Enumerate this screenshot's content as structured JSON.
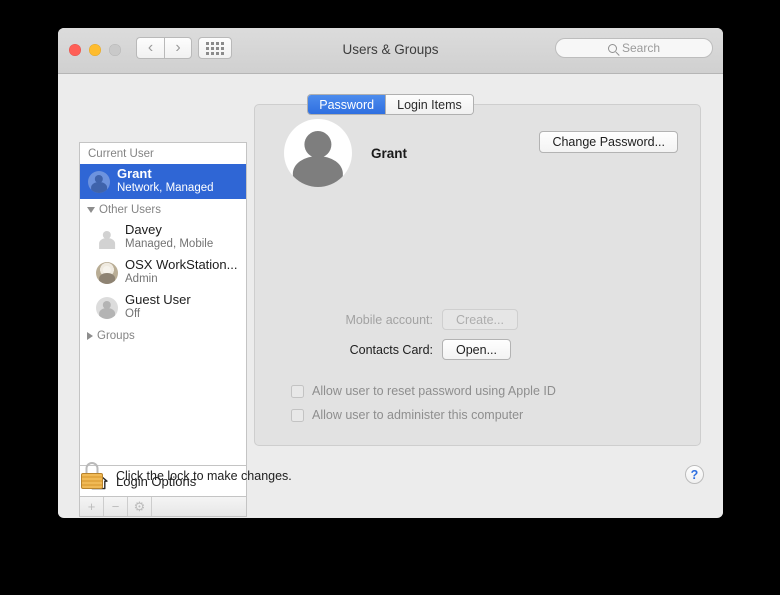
{
  "window": {
    "title": "Users & Groups",
    "traffic_lights": [
      "close",
      "minimize",
      "zoom"
    ],
    "nav_back": "‹",
    "nav_forward": "›",
    "grid_button": "show-all-icon"
  },
  "search": {
    "placeholder": "Search",
    "value": "",
    "icon": "search-icon"
  },
  "sidebar": {
    "current_user_header": "Current User",
    "other_users_header": "Other Users",
    "groups_header": "Groups",
    "users": [
      {
        "name": "Grant",
        "subtitle": "Network, Managed",
        "selected": true,
        "avatar": "blue-silhouette"
      },
      {
        "name": "Davey",
        "subtitle": "Managed, Mobile",
        "selected": false,
        "avatar": "plain-silhouette"
      },
      {
        "name": "OSX WorkStation...",
        "subtitle": "Admin",
        "selected": false,
        "avatar": "photo"
      },
      {
        "name": "Guest User",
        "subtitle": "Off",
        "selected": false,
        "avatar": "gray-circle-silhouette"
      }
    ],
    "login_options": "Login Options",
    "login_options_icon": "home-icon",
    "tools": [
      {
        "label": "+",
        "name": "add-user-button",
        "enabled": false
      },
      {
        "label": "−",
        "name": "remove-user-button",
        "enabled": false
      },
      {
        "label": "⚙",
        "name": "settings-gear-button",
        "enabled": false
      }
    ]
  },
  "tabs": [
    {
      "label": "Password",
      "active": true
    },
    {
      "label": "Login Items",
      "active": false
    }
  ],
  "main": {
    "user_name": "Grant",
    "avatar": "user-silhouette",
    "change_password_label": "Change Password...",
    "rows": [
      {
        "label": "Mobile account:",
        "button": "Create...",
        "enabled": false
      },
      {
        "label": "Contacts Card:",
        "button": "Open...",
        "enabled": true
      }
    ],
    "checkboxes": [
      {
        "label": "Allow user to reset password using Apple ID",
        "checked": false,
        "enabled": false
      },
      {
        "label": "Allow user to administer this computer",
        "checked": false,
        "enabled": false
      }
    ]
  },
  "footer": {
    "lock_icon": "lock-closed-icon",
    "lock_text": "Click the lock to make changes.",
    "help_label": "?"
  },
  "colors": {
    "selection_blue": "#2f66d5",
    "tab_active_blue": "#2f6fe0",
    "window_bg": "#ececec",
    "pane_bg": "#e2e2e2",
    "lock_gold": "#e3a740",
    "help_blue": "#2f6fe0"
  }
}
